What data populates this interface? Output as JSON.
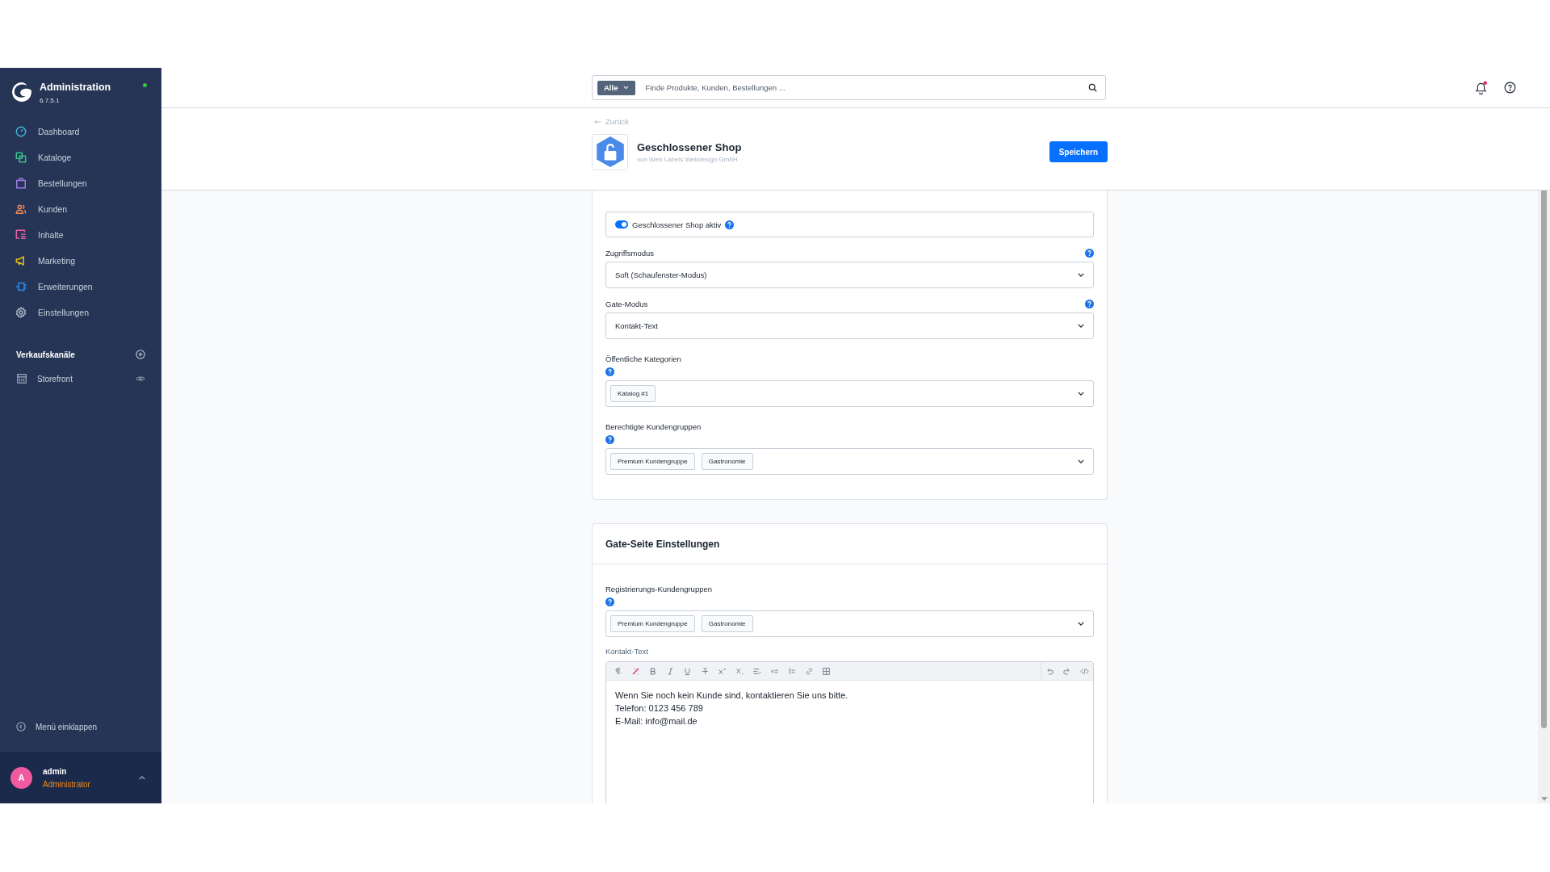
{
  "sidebar": {
    "title": "Administration",
    "version": "6.7.5.1",
    "online": true,
    "items": [
      {
        "label": "Dashboard",
        "kind": "dashboard",
        "color": "#3fb6e0"
      },
      {
        "label": "Kataloge",
        "kind": "catalog",
        "color": "#37c08a"
      },
      {
        "label": "Bestellungen",
        "kind": "orders",
        "color": "#9c7be6"
      },
      {
        "label": "Kunden",
        "kind": "customers",
        "color": "#f08a5d"
      },
      {
        "label": "Inhalte",
        "kind": "content",
        "color": "#ef5fa7"
      },
      {
        "label": "Marketing",
        "kind": "marketing",
        "color": "#e5c21a"
      },
      {
        "label": "Erweiterungen",
        "kind": "extensions",
        "color": "#2b8cf0"
      },
      {
        "label": "Einstellungen",
        "kind": "settings",
        "color": "#a8b4c4"
      }
    ],
    "sales_channels": {
      "title": "Verkaufskanäle",
      "items": [
        {
          "label": "Storefront"
        }
      ]
    },
    "collapse": "Menü einklappen",
    "user": {
      "initial": "A",
      "name": "admin",
      "role": "Administrator"
    }
  },
  "search": {
    "filter": "Alle",
    "placeholder": "Finde Produkte, Kunden, Bestellungen ..."
  },
  "notifications": {
    "unread": true
  },
  "header": {
    "back": "Zurück",
    "title": "Geschlossener Shop",
    "subtitle": "von Web Labels Webdesign GmbH",
    "save": "Speichern"
  },
  "settings_card": {
    "toggle": {
      "label": "Geschlossener Shop aktiv",
      "on": true
    },
    "fields": [
      {
        "kind": "select",
        "label": "Zugriffsmodus",
        "value": "Soft (Schaufenster-Modus)"
      },
      {
        "kind": "select",
        "label": "Gate-Modus",
        "value": "Kontakt-Text"
      },
      {
        "kind": "multiselect",
        "label": "Öffentliche Kategorien",
        "tags": [
          "Katalog #1"
        ]
      },
      {
        "kind": "multiselect",
        "label": "Berechtigte Kundengruppen",
        "tags": [
          "Premium Kundengruppe",
          "Gastronomie"
        ]
      }
    ]
  },
  "gate_card": {
    "title": "Gate-Seite Einstellungen",
    "fields": [
      {
        "kind": "multiselect",
        "label": "Registrierungs-Kundengruppen",
        "tags": [
          "Premium Kundengruppe",
          "Gastronomie"
        ]
      }
    ],
    "editor": {
      "label": "Kontakt-Text",
      "toolbar": [
        {
          "kind": "paragraph"
        },
        {
          "kind": "clear"
        },
        {
          "kind": "bold"
        },
        {
          "kind": "italic"
        },
        {
          "kind": "underline"
        },
        {
          "kind": "strike"
        },
        {
          "kind": "sup"
        },
        {
          "kind": "sub"
        },
        {
          "kind": "align"
        },
        {
          "kind": "bullets"
        },
        {
          "kind": "numbers"
        },
        {
          "kind": "link"
        },
        {
          "kind": "table"
        }
      ],
      "toolbar_right": [
        {
          "kind": "undo"
        },
        {
          "kind": "redo"
        },
        {
          "kind": "code"
        }
      ],
      "lines": [
        "Wenn Sie noch kein Kunde sind, kontaktieren Sie uns bitte.",
        "Telefon: 0123 456 789",
        "E-Mail: info@mail.de"
      ]
    }
  }
}
